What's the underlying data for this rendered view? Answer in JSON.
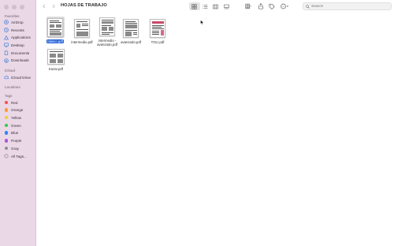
{
  "window": {
    "title": "HOJAS DE TRABAJO"
  },
  "search": {
    "placeholder": "Search"
  },
  "sidebar": {
    "favorites_title": "Favorites",
    "favorites": [
      {
        "label": "AirDrop",
        "icon": "airdrop-icon"
      },
      {
        "label": "Recents",
        "icon": "clock-icon"
      },
      {
        "label": "Applications",
        "icon": "applications-icon"
      },
      {
        "label": "Desktop",
        "icon": "desktop-icon"
      },
      {
        "label": "Documents",
        "icon": "document-icon"
      },
      {
        "label": "Downloads",
        "icon": "download-icon"
      }
    ],
    "icloud_title": "iCloud",
    "icloud": [
      {
        "label": "iCloud Drive",
        "icon": "cloud-icon"
      }
    ],
    "locations_title": "Locations",
    "tags_title": "Tags",
    "tags": [
      {
        "label": "Red",
        "color": "#ff4b4b"
      },
      {
        "label": "Orange",
        "color": "#ff9a2e"
      },
      {
        "label": "Yellow",
        "color": "#f5cc2a"
      },
      {
        "label": "Green",
        "color": "#33c84a"
      },
      {
        "label": "Blue",
        "color": "#2f86f6"
      },
      {
        "label": "Purple",
        "color": "#b157d6"
      },
      {
        "label": "Gray",
        "color": "#8e8e93"
      }
    ],
    "all_tags": "All Tags..."
  },
  "files": [
    {
      "name": "básico.pdf",
      "selected": true
    },
    {
      "name": "intermedio.pdf",
      "selected": false
    },
    {
      "name_line1": "intermedio -",
      "name_line2": "avanzado.pdf",
      "selected": false
    },
    {
      "name": "avanzado.pdf",
      "selected": false
    },
    {
      "name": "TOLI.pdf",
      "selected": false
    },
    {
      "name": "trazar.pdf",
      "selected": false
    }
  ],
  "colors": {
    "accent": "#1e5fd6",
    "sidebar_bg": "#ead8e7"
  }
}
